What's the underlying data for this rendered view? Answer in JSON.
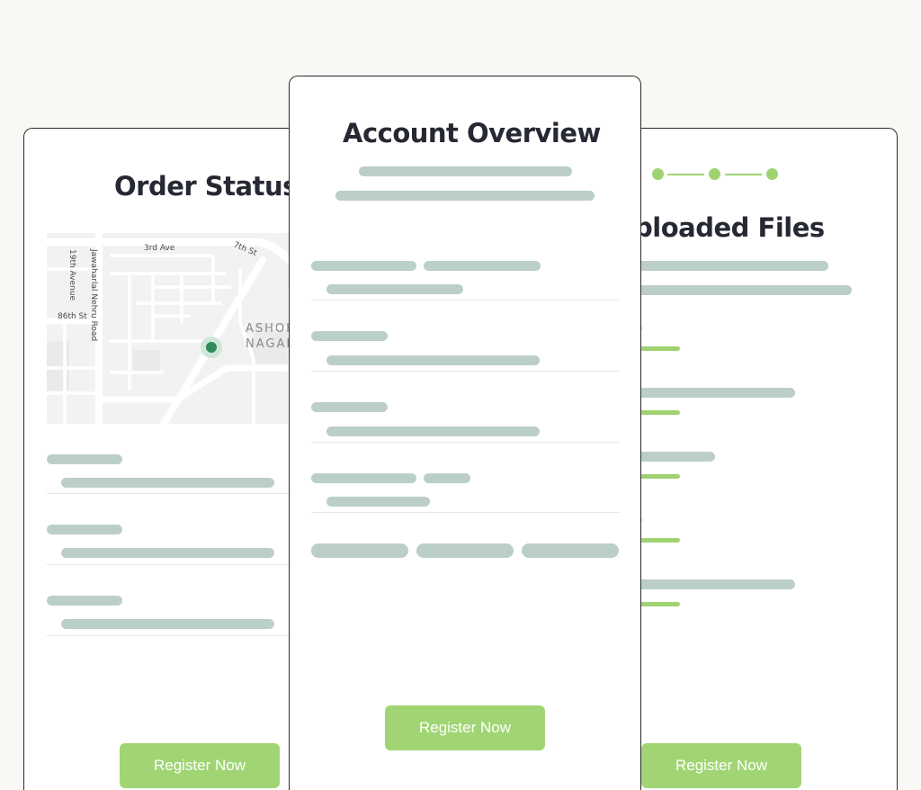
{
  "cards": {
    "order_status": {
      "title": "Order Status",
      "button_label": "Register Now",
      "map": {
        "streets": [
          "3rd Ave",
          "7th St",
          "19th Avenue",
          "Jawaharlal Nehru Road",
          "86th St"
        ],
        "district_line1": "ASHOK",
        "district_line2": "NAGAR",
        "pin_color": "#2f8a5c"
      }
    },
    "account_overview": {
      "title": "Account Overview",
      "button_label": "Register Now"
    },
    "uploaded_files": {
      "title": "Uploaded Files",
      "button_label": "Register Now",
      "stepper_steps": 3
    }
  },
  "colors": {
    "background": "#f9f8f4",
    "card": "#ffffff",
    "accent": "#a1d574",
    "placeholder": "#bccfc6",
    "heading": "#262833"
  }
}
